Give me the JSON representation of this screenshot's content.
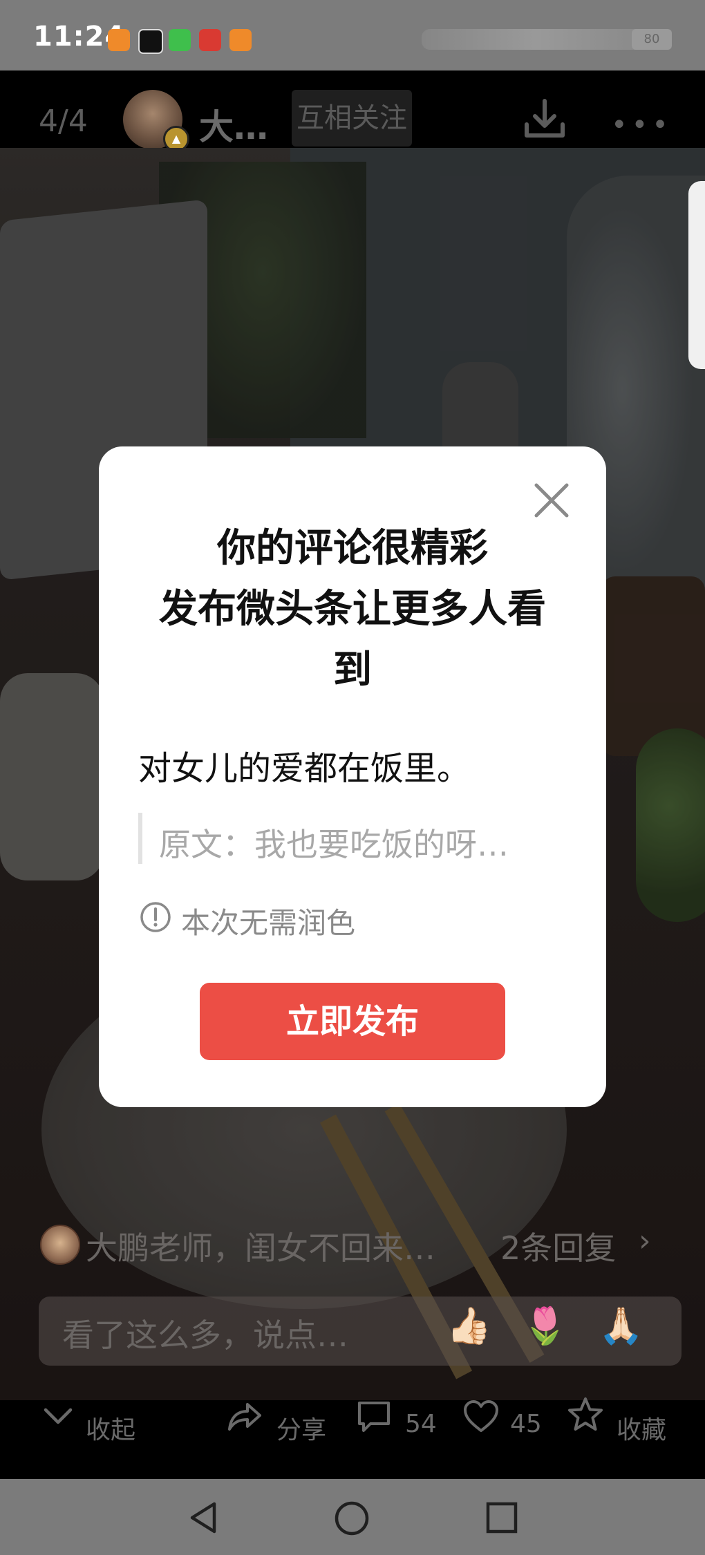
{
  "status_bar": {
    "time": "11:24",
    "battery_label": "80"
  },
  "top_bar": {
    "pager": "4/4",
    "author_name": "大…",
    "follow_label": "互相关注",
    "more_label": "•••"
  },
  "dialog": {
    "title_lines": [
      "你的评论很精彩",
      "发布微头条让更多人看",
      "到"
    ],
    "comment": "对女儿的爱都在饭里。",
    "original_prefix": "原文：",
    "original_text": "我也要吃饭的呀…",
    "info_text": "本次无需润色",
    "publish_label": "立即发布"
  },
  "comments": {
    "preview_text": "大鹏老师，闺女不回来…",
    "reply_count": "2条回复",
    "input_placeholder": "看了这么多，说点…",
    "emojis": [
      "👍🏻",
      "🌷",
      "🙏🏻"
    ]
  },
  "action_bar": {
    "collapse_label": "收起",
    "share_label": "分享",
    "comment_count": "54",
    "like_count": "45",
    "favorite_label": "收藏"
  },
  "colors": {
    "accent": "#ec4e45",
    "status_bar": "#7c7c7c",
    "nav_bar": "#7b7b7b"
  }
}
